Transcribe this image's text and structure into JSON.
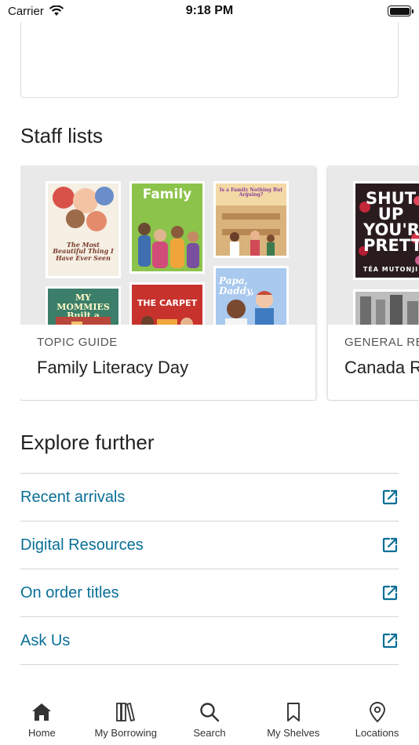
{
  "status_bar": {
    "carrier": "Carrier",
    "time": "9:18 PM"
  },
  "staff_lists": {
    "heading": "Staff lists",
    "cards": [
      {
        "tag": "TOPIC GUIDE",
        "title": "Family Literacy Day",
        "books": [
          {
            "title": "The Most Beautiful Thing I Have Ever Seen"
          },
          {
            "title": "Family"
          },
          {
            "title": "Is a Family Nothing But Arguing?"
          },
          {
            "title": "MY MOMMIES Built a Treehouse"
          },
          {
            "title": "THE CARPET"
          },
          {
            "title": "Papa, Daddy,"
          }
        ]
      },
      {
        "tag": "GENERAL REC",
        "title": "Canada R",
        "books": [
          {
            "title": "SHUT UP YOU'RE PRETTY",
            "author": "TÉA MUTONJI"
          }
        ]
      }
    ]
  },
  "explore": {
    "heading": "Explore further",
    "links": [
      {
        "label": "Recent arrivals"
      },
      {
        "label": "Digital Resources"
      },
      {
        "label": "On order titles"
      },
      {
        "label": "Ask Us"
      }
    ]
  },
  "tabs": [
    {
      "label": "Home",
      "icon": "home-icon"
    },
    {
      "label": "My Borrowing",
      "icon": "books-icon"
    },
    {
      "label": "Search",
      "icon": "search-icon"
    },
    {
      "label": "My Shelves",
      "icon": "bookmark-icon"
    },
    {
      "label": "Locations",
      "icon": "location-pin-icon"
    }
  ],
  "colors": {
    "link": "#0a6f97",
    "tab_icon": "#333333"
  }
}
